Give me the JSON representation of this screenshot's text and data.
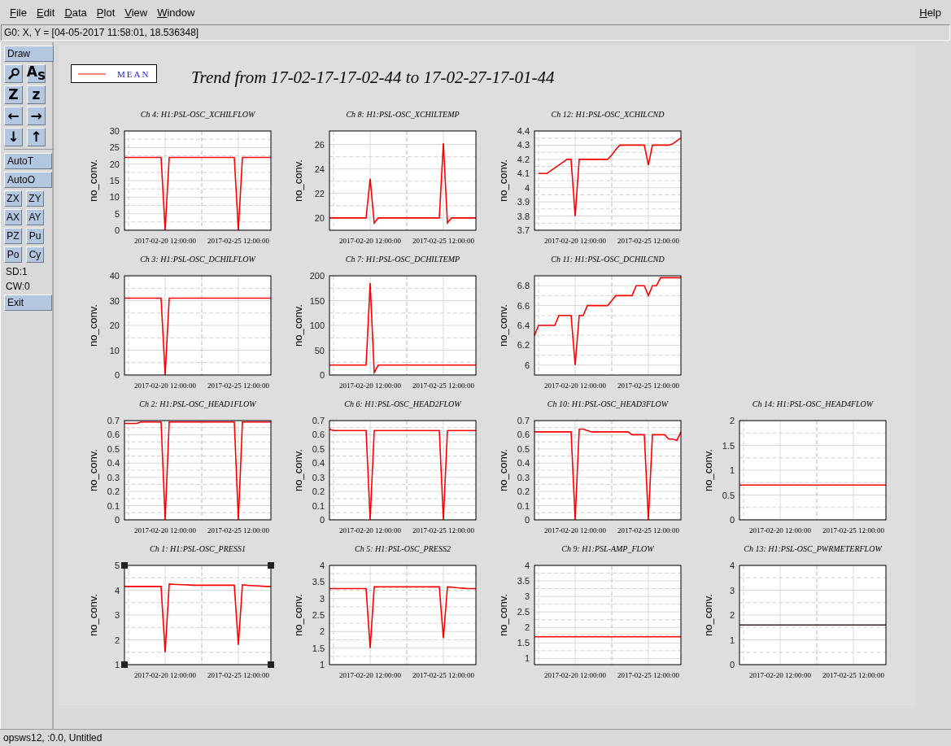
{
  "menu": [
    "File",
    "Edit",
    "Data",
    "Plot",
    "View",
    "Window"
  ],
  "help": "Help",
  "coords": "G0: X, Y = [04-05-2017 11:58:01, 18.536348]",
  "tools_top": [
    [
      {
        "kind": "wide",
        "label": "Draw"
      }
    ],
    [
      {
        "kind": "magnifier"
      },
      {
        "kind": "glyph",
        "label": "A$_{S}$"
      }
    ],
    [
      {
        "kind": "glyph",
        "label": "Z"
      },
      {
        "kind": "glyph",
        "label": "z"
      }
    ],
    [
      {
        "kind": "glyph",
        "label": "←"
      },
      {
        "kind": "glyph",
        "label": "→"
      }
    ],
    [
      {
        "kind": "glyph",
        "label": "↓"
      },
      {
        "kind": "glyph",
        "label": "↑"
      }
    ]
  ],
  "tools_bottom": [
    [
      {
        "kind": "wide",
        "label": "AutoT"
      }
    ],
    [
      {
        "kind": "wide",
        "label": "AutoO"
      }
    ],
    [
      {
        "kind": "small",
        "label": "ZX"
      },
      {
        "kind": "small",
        "label": "ZY"
      }
    ],
    [
      {
        "kind": "small",
        "label": "AX"
      },
      {
        "kind": "small",
        "label": "AY"
      }
    ],
    [
      {
        "kind": "small",
        "label": "PZ"
      },
      {
        "kind": "small",
        "label": "Pu"
      }
    ],
    [
      {
        "kind": "small",
        "label": "Po"
      },
      {
        "kind": "small",
        "label": "Cy"
      }
    ],
    [
      {
        "kind": "text",
        "label": "SD:1"
      }
    ],
    [
      {
        "kind": "text",
        "label": "CW:0"
      }
    ],
    [
      {
        "kind": "wide",
        "label": "Exit"
      }
    ]
  ],
  "legend": {
    "label": "MEAN"
  },
  "title": "Trend from 17-02-17-17-02-44 to 17-02-27-17-01-44",
  "plot_rows": [
    [
      {
        "selected": false,
        "chart_data": {
          "type": "line",
          "title": "Ch 4: H1:PSL-OSC_XCHILFLOW",
          "grid": true,
          "ylabel": "no_conv.",
          "categories": [
            null,
            null,
            null,
            null,
            null,
            null,
            null,
            null,
            null,
            null,
            "2017-02-20 12:00:00",
            null,
            null,
            null,
            null,
            null,
            null,
            null,
            null,
            null,
            null,
            null,
            null,
            null,
            null,
            null,
            null,
            null,
            "2017-02-25 12:00:00",
            null,
            null,
            null,
            null,
            null,
            null,
            null,
            null
          ],
          "series": [
            {
              "color": "#ff0000",
              "values": [
                22,
                22,
                22,
                22,
                22,
                22,
                22,
                22,
                22,
                22,
                0,
                22,
                22,
                22,
                22,
                22,
                22,
                22,
                22,
                22,
                22,
                22,
                22,
                22,
                22,
                22,
                22,
                22,
                0,
                22,
                22,
                22,
                22,
                22,
                22,
                22,
                22
              ]
            }
          ],
          "ylim": [
            0,
            30
          ],
          "yticks": [
            0,
            5,
            10,
            15,
            20,
            25,
            30
          ]
        }
      },
      {
        "selected": false,
        "chart_data": {
          "type": "line",
          "title": "Ch 8: H1:PSL-OSC_XCHILTEMP",
          "grid": true,
          "ylabel": "no_conv.",
          "categories": [
            null,
            null,
            null,
            null,
            null,
            null,
            null,
            null,
            null,
            null,
            "2017-02-20 12:00:00",
            null,
            null,
            null,
            null,
            null,
            null,
            null,
            null,
            null,
            null,
            null,
            null,
            null,
            null,
            null,
            null,
            null,
            "2017-02-25 12:00:00",
            null,
            null,
            null,
            null,
            null,
            null,
            null,
            null
          ],
          "series": [
            {
              "color": "#ff0000",
              "values": [
                20,
                20,
                20,
                20,
                20,
                20,
                20,
                20,
                20,
                20,
                23.2,
                19.6,
                20,
                20,
                20,
                20,
                20,
                20,
                20,
                20,
                20,
                20,
                20,
                20,
                20,
                20,
                20,
                20,
                26.1,
                19.6,
                20,
                20,
                20,
                20,
                20,
                20,
                20
              ]
            }
          ],
          "ylim": [
            19,
            27.1
          ],
          "yticks": [
            20,
            22,
            24,
            26
          ]
        }
      },
      {
        "selected": false,
        "chart_data": {
          "type": "line",
          "title": "Ch 12: H1:PSL-OSC_XCHILCND",
          "grid": true,
          "ylabel": "no_conv.",
          "categories": [
            null,
            null,
            null,
            null,
            null,
            null,
            null,
            null,
            null,
            null,
            "2017-02-20 12:00:00",
            null,
            null,
            null,
            null,
            null,
            null,
            null,
            null,
            null,
            null,
            null,
            null,
            null,
            null,
            null,
            null,
            null,
            "2017-02-25 12:00:00",
            null,
            null,
            null,
            null,
            null,
            null,
            null,
            null
          ],
          "series": [
            {
              "color": "#ff0000",
              "values": [
                null,
                4.1,
                4.1,
                4.1,
                4.12,
                4.14,
                4.16,
                4.18,
                4.2,
                4.2,
                3.8,
                4.2,
                4.2,
                4.2,
                4.2,
                4.2,
                4.2,
                4.2,
                4.2,
                4.23,
                4.27,
                4.3,
                4.3,
                4.3,
                4.3,
                4.3,
                4.3,
                4.3,
                4.16,
                4.3,
                4.3,
                4.3,
                4.3,
                4.3,
                4.31,
                4.33,
                4.35
              ]
            }
          ],
          "ylim": [
            3.7,
            4.4
          ],
          "yticks": [
            3.7,
            3.8,
            3.9,
            4,
            4.1,
            4.2,
            4.3,
            4.4
          ]
        }
      }
    ],
    [
      {
        "selected": false,
        "chart_data": {
          "type": "line",
          "title": "Ch 3: H1:PSL-OSC_DCHILFLOW",
          "grid": true,
          "ylabel": "no_conv.",
          "categories": [
            null,
            null,
            null,
            null,
            null,
            null,
            null,
            null,
            null,
            null,
            "2017-02-20 12:00:00",
            null,
            null,
            null,
            null,
            null,
            null,
            null,
            null,
            null,
            null,
            null,
            null,
            null,
            null,
            null,
            null,
            null,
            "2017-02-25 12:00:00",
            null,
            null,
            null,
            null,
            null,
            null,
            null,
            null
          ],
          "series": [
            {
              "color": "#ff0000",
              "values": [
                31,
                31,
                31,
                31,
                31,
                31,
                31,
                31,
                31,
                31,
                0,
                31,
                31,
                31,
                31,
                31,
                31,
                31,
                31,
                31,
                31,
                31,
                31,
                31,
                31,
                31,
                31,
                31,
                31,
                31,
                31,
                31,
                31,
                31,
                31,
                31,
                31
              ]
            }
          ],
          "ylim": [
            0,
            40
          ],
          "yticks": [
            0,
            10,
            20,
            30,
            40
          ]
        }
      },
      {
        "selected": false,
        "chart_data": {
          "type": "line",
          "title": "Ch 7: H1:PSL-OSC_DCHILTEMP",
          "grid": true,
          "ylabel": "no_conv.",
          "categories": [
            null,
            null,
            null,
            null,
            null,
            null,
            null,
            null,
            null,
            null,
            "2017-02-20 12:00:00",
            null,
            null,
            null,
            null,
            null,
            null,
            null,
            null,
            null,
            null,
            null,
            null,
            null,
            null,
            null,
            null,
            null,
            "2017-02-25 12:00:00",
            null,
            null,
            null,
            null,
            null,
            null,
            null,
            null
          ],
          "series": [
            {
              "color": "#ff0000",
              "values": [
                20,
                20,
                20,
                20,
                20,
                20,
                20,
                20,
                20,
                20,
                185,
                5,
                20,
                20,
                20,
                20,
                20,
                20,
                20,
                20,
                20,
                20,
                20,
                20,
                20,
                20,
                20,
                20,
                20,
                20,
                20,
                20,
                20,
                20,
                20,
                20,
                20
              ]
            }
          ],
          "ylim": [
            0,
            200
          ],
          "yticks": [
            0,
            50,
            100,
            150,
            200
          ]
        }
      },
      {
        "selected": false,
        "chart_data": {
          "type": "line",
          "title": "Ch 11: H1:PSL-OSC_DCHILCND",
          "grid": true,
          "ylabel": "no_conv.",
          "categories": [
            null,
            null,
            null,
            null,
            null,
            null,
            null,
            null,
            null,
            null,
            "2017-02-20 12:00:00",
            null,
            null,
            null,
            null,
            null,
            null,
            null,
            null,
            null,
            null,
            null,
            null,
            null,
            null,
            null,
            null,
            null,
            "2017-02-25 12:00:00",
            null,
            null,
            null,
            null,
            null,
            null,
            null,
            null
          ],
          "series": [
            {
              "color": "#ff0000",
              "values": [
                6.3,
                6.4,
                6.4,
                6.4,
                6.4,
                6.4,
                6.5,
                6.5,
                6.5,
                6.5,
                6.0,
                6.5,
                6.5,
                6.6,
                6.6,
                6.6,
                6.6,
                6.6,
                6.6,
                6.65,
                6.7,
                6.7,
                6.7,
                6.7,
                6.7,
                6.8,
                6.8,
                6.8,
                6.7,
                6.8,
                6.8,
                6.88,
                6.88,
                6.88,
                6.88,
                6.88,
                6.88
              ]
            }
          ],
          "ylim": [
            5.9,
            6.9
          ],
          "yticks": [
            6,
            6.2,
            6.4,
            6.6,
            6.8
          ]
        }
      }
    ],
    [
      {
        "selected": false,
        "chart_data": {
          "type": "line",
          "title": "Ch 2: H1:PSL-OSC_HEAD1FLOW",
          "grid": true,
          "ylabel": "no_conv.",
          "categories": [
            null,
            null,
            null,
            null,
            null,
            null,
            null,
            null,
            null,
            null,
            "2017-02-20 12:00:00",
            null,
            null,
            null,
            null,
            null,
            null,
            null,
            null,
            null,
            null,
            null,
            null,
            null,
            null,
            null,
            null,
            null,
            "2017-02-25 12:00:00",
            null,
            null,
            null,
            null,
            null,
            null,
            null,
            null
          ],
          "series": [
            {
              "color": "#ff0000",
              "values": [
                0.68,
                0.68,
                0.68,
                0.68,
                0.69,
                0.69,
                0.69,
                0.69,
                0.69,
                0.69,
                0,
                0.69,
                0.69,
                0.69,
                0.69,
                0.69,
                0.69,
                0.69,
                0.69,
                0.69,
                0.69,
                0.69,
                0.69,
                0.69,
                0.69,
                0.69,
                0.69,
                0.69,
                0,
                0.69,
                0.69,
                0.69,
                0.69,
                0.69,
                0.69,
                0.69,
                0.69
              ]
            }
          ],
          "ylim": [
            0,
            0.7
          ],
          "yticks": [
            0,
            0.1,
            0.2,
            0.3,
            0.4,
            0.5,
            0.6,
            0.7
          ]
        }
      },
      {
        "selected": false,
        "chart_data": {
          "type": "line",
          "title": "Ch 6: H1:PSL-OSC_HEAD2FLOW",
          "grid": true,
          "ylabel": "no_conv.",
          "categories": [
            null,
            null,
            null,
            null,
            null,
            null,
            null,
            null,
            null,
            null,
            "2017-02-20 12:00:00",
            null,
            null,
            null,
            null,
            null,
            null,
            null,
            null,
            null,
            null,
            null,
            null,
            null,
            null,
            null,
            null,
            null,
            "2017-02-25 12:00:00",
            null,
            null,
            null,
            null,
            null,
            null,
            null,
            null
          ],
          "series": [
            {
              "color": "#ff0000",
              "values": [
                0.64,
                0.63,
                0.63,
                0.63,
                0.63,
                0.63,
                0.63,
                0.63,
                0.63,
                0.63,
                0,
                0.63,
                0.63,
                0.63,
                0.63,
                0.63,
                0.63,
                0.63,
                0.63,
                0.63,
                0.63,
                0.63,
                0.63,
                0.63,
                0.63,
                0.63,
                0.63,
                0.63,
                0,
                0.63,
                0.63,
                0.63,
                0.63,
                0.63,
                0.63,
                0.63,
                0.63
              ]
            }
          ],
          "ylim": [
            0,
            0.7
          ],
          "yticks": [
            0,
            0.1,
            0.2,
            0.3,
            0.4,
            0.5,
            0.6,
            0.7
          ]
        }
      },
      {
        "selected": false,
        "chart_data": {
          "type": "line",
          "title": "Ch 10: H1:PSL-OSC_HEAD3FLOW",
          "grid": true,
          "ylabel": "no_conv.",
          "categories": [
            null,
            null,
            null,
            null,
            null,
            null,
            null,
            null,
            null,
            null,
            "2017-02-20 12:00:00",
            null,
            null,
            null,
            null,
            null,
            null,
            null,
            null,
            null,
            null,
            null,
            null,
            null,
            null,
            null,
            null,
            null,
            "2017-02-25 12:00:00",
            null,
            null,
            null,
            null,
            null,
            null,
            null,
            null
          ],
          "series": [
            {
              "color": "#ff0000",
              "values": [
                0.62,
                0.62,
                0.62,
                0.62,
                0.62,
                0.62,
                0.62,
                0.62,
                0.62,
                0.62,
                0,
                0.64,
                0.64,
                0.63,
                0.62,
                0.62,
                0.62,
                0.62,
                0.62,
                0.62,
                0.62,
                0.62,
                0.62,
                0.62,
                0.6,
                0.6,
                0.6,
                0.6,
                0,
                0.6,
                0.6,
                0.6,
                0.6,
                0.57,
                0.57,
                0.56,
                0.62
              ]
            }
          ],
          "ylim": [
            0,
            0.7
          ],
          "yticks": [
            0,
            0.1,
            0.2,
            0.3,
            0.4,
            0.5,
            0.6,
            0.7
          ]
        }
      },
      {
        "selected": false,
        "chart_data": {
          "type": "line",
          "title": "Ch 14: H1:PSL-OSC_HEAD4FLOW",
          "grid": true,
          "ylabel": "no_conv.",
          "categories": [
            null,
            null,
            null,
            null,
            null,
            null,
            null,
            null,
            null,
            null,
            "2017-02-20 12:00:00",
            null,
            null,
            null,
            null,
            null,
            null,
            null,
            null,
            null,
            null,
            null,
            null,
            null,
            null,
            null,
            null,
            null,
            "2017-02-25 12:00:00",
            null,
            null,
            null,
            null,
            null,
            null,
            null,
            null
          ],
          "series": [
            {
              "color": "#ff0000",
              "values": [
                0.7,
                0.7,
                0.7,
                0.7,
                0.7,
                0.7,
                0.7,
                0.7,
                0.7,
                0.7,
                0.7,
                0.7,
                0.7,
                0.7,
                0.7,
                0.7,
                0.7,
                0.7,
                0.7,
                0.7,
                0.7,
                0.7,
                0.7,
                0.7,
                0.7,
                0.7,
                0.7,
                0.7,
                0.7,
                0.7,
                0.7,
                0.7,
                0.7,
                0.7,
                0.7,
                0.7,
                0.7
              ]
            }
          ],
          "ylim": [
            0,
            2
          ],
          "yticks": [
            0,
            0.5,
            1,
            1.5,
            2
          ]
        }
      }
    ],
    [
      {
        "selected": true,
        "chart_data": {
          "type": "line",
          "title": "Ch 1: H1:PSL-OSC_PRESS1",
          "grid": true,
          "ylabel": "no_conv.",
          "categories": [
            null,
            null,
            null,
            null,
            null,
            null,
            null,
            null,
            null,
            null,
            "2017-02-20 12:00:00",
            null,
            null,
            null,
            null,
            null,
            null,
            null,
            null,
            null,
            null,
            null,
            null,
            null,
            null,
            null,
            null,
            null,
            "2017-02-25 12:00:00",
            null,
            null,
            null,
            null,
            null,
            null,
            null,
            null
          ],
          "series": [
            {
              "color": "#ff0000",
              "values": [
                4.15,
                4.15,
                4.15,
                4.15,
                4.15,
                4.15,
                4.15,
                4.15,
                4.15,
                4.15,
                1.5,
                4.25,
                4.24,
                4.23,
                4.22,
                4.22,
                4.21,
                4.2,
                4.2,
                4.2,
                4.2,
                4.2,
                4.2,
                4.2,
                4.2,
                4.2,
                4.2,
                4.2,
                1.8,
                4.22,
                4.2,
                4.19,
                4.18,
                4.17,
                4.16,
                4.15,
                4.15
              ]
            }
          ],
          "ylim": [
            1,
            5
          ],
          "yticks": [
            1,
            2,
            3,
            4,
            5
          ]
        }
      },
      {
        "selected": false,
        "chart_data": {
          "type": "line",
          "title": "Ch 5: H1:PSL-OSC_PRESS2",
          "grid": true,
          "ylabel": "no_conv.",
          "categories": [
            null,
            null,
            null,
            null,
            null,
            null,
            null,
            null,
            null,
            null,
            "2017-02-20 12:00:00",
            null,
            null,
            null,
            null,
            null,
            null,
            null,
            null,
            null,
            null,
            null,
            null,
            null,
            null,
            null,
            null,
            null,
            "2017-02-25 12:00:00",
            null,
            null,
            null,
            null,
            null,
            null,
            null,
            null
          ],
          "series": [
            {
              "color": "#ff0000",
              "values": [
                3.3,
                3.3,
                3.3,
                3.3,
                3.3,
                3.3,
                3.3,
                3.3,
                3.3,
                3.3,
                1.5,
                3.35,
                3.35,
                3.35,
                3.35,
                3.35,
                3.35,
                3.35,
                3.35,
                3.35,
                3.35,
                3.35,
                3.35,
                3.35,
                3.35,
                3.35,
                3.35,
                3.35,
                1.8,
                3.35,
                3.34,
                3.33,
                3.32,
                3.31,
                3.3,
                3.3,
                3.3
              ]
            }
          ],
          "ylim": [
            1,
            4
          ],
          "yticks": [
            1,
            1.5,
            2,
            2.5,
            3,
            3.5,
            4
          ]
        }
      },
      {
        "selected": false,
        "chart_data": {
          "type": "line",
          "title": "Ch 9: H1:PSL-AMP_FLOW",
          "grid": true,
          "ylabel": "no_conv.",
          "categories": [
            null,
            null,
            null,
            null,
            null,
            null,
            null,
            null,
            null,
            null,
            "2017-02-20 12:00:00",
            null,
            null,
            null,
            null,
            null,
            null,
            null,
            null,
            null,
            null,
            null,
            null,
            null,
            null,
            null,
            null,
            null,
            "2017-02-25 12:00:00",
            null,
            null,
            null,
            null,
            null,
            null,
            null,
            null
          ],
          "series": [
            {
              "color": "#ff0000",
              "values": [
                1.7,
                1.7,
                1.7,
                1.7,
                1.7,
                1.7,
                1.7,
                1.7,
                1.7,
                1.7,
                1.7,
                1.7,
                1.7,
                1.7,
                1.7,
                1.7,
                1.7,
                1.7,
                1.7,
                1.7,
                1.7,
                1.7,
                1.7,
                1.7,
                1.7,
                1.7,
                1.7,
                1.7,
                1.7,
                1.7,
                1.7,
                1.7,
                1.7,
                1.7,
                1.7,
                1.7,
                1.7
              ]
            }
          ],
          "ylim": [
            0.8,
            4
          ],
          "yticks": [
            1,
            1.5,
            2,
            2.5,
            3,
            3.5,
            4
          ]
        }
      },
      {
        "selected": false,
        "chart_data": {
          "type": "line",
          "title": "Ch 13: H1:PSL-OSC_PWRMETERFLOW",
          "grid": true,
          "ylabel": "no_conv.",
          "categories": [
            null,
            null,
            null,
            null,
            null,
            null,
            null,
            null,
            null,
            null,
            "2017-02-20 12:00:00",
            null,
            null,
            null,
            null,
            null,
            null,
            null,
            null,
            null,
            null,
            null,
            null,
            null,
            null,
            null,
            null,
            null,
            "2017-02-25 12:00:00",
            null,
            null,
            null,
            null,
            null,
            null,
            null,
            null
          ],
          "series": [
            {
              "color": "#402020",
              "values": [
                1.6,
                1.6,
                1.6,
                1.6,
                1.6,
                1.6,
                1.6,
                1.6,
                1.6,
                1.6,
                1.6,
                1.6,
                1.6,
                1.6,
                1.6,
                1.6,
                1.6,
                1.6,
                1.6,
                1.6,
                1.6,
                1.6,
                1.6,
                1.6,
                1.6,
                1.6,
                1.6,
                1.6,
                1.6,
                1.6,
                1.6,
                1.6,
                1.6,
                1.6,
                1.6,
                1.6,
                1.6
              ]
            }
          ],
          "ylim": [
            0,
            4
          ],
          "yticks": [
            0,
            1,
            2,
            3,
            4
          ]
        }
      }
    ]
  ],
  "status": "opsws12, :0.0, Untitled"
}
